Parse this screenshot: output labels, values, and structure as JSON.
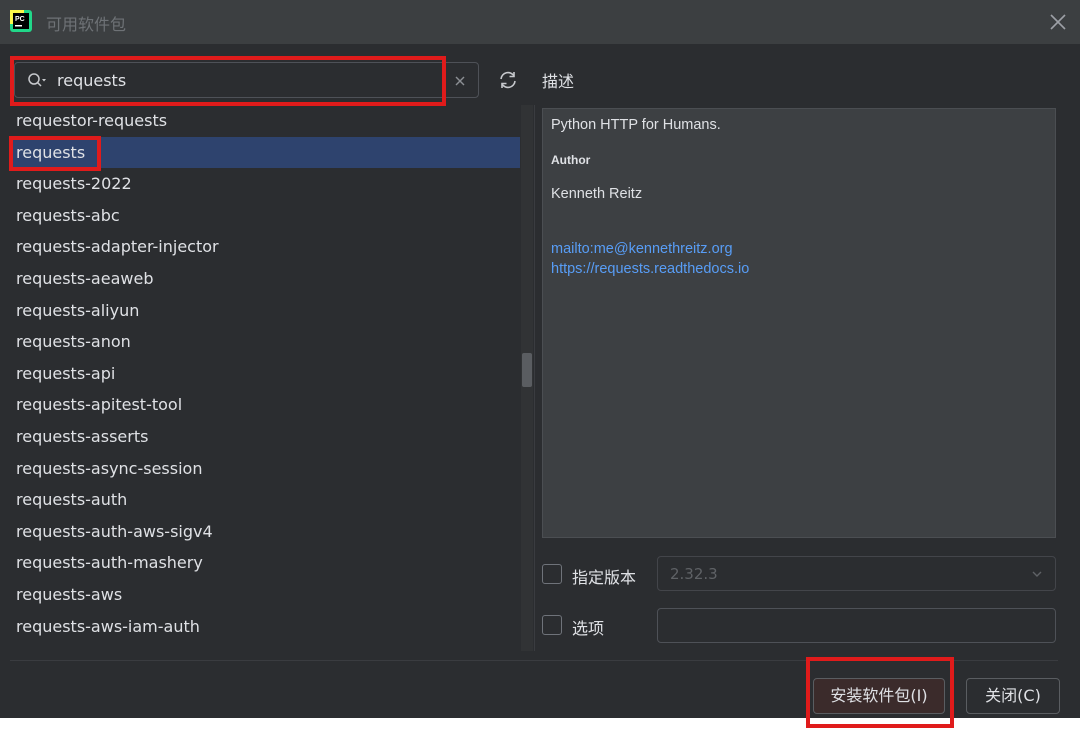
{
  "window": {
    "title": "可用软件包"
  },
  "search": {
    "value": "requests"
  },
  "packages": [
    "requestor-requests",
    "requests",
    "requests-2022",
    "requests-abc",
    "requests-adapter-injector",
    "requests-aeaweb",
    "requests-aliyun",
    "requests-anon",
    "requests-api",
    "requests-apitest-tool",
    "requests-asserts",
    "requests-async-session",
    "requests-auth",
    "requests-auth-aws-sigv4",
    "requests-auth-mashery",
    "requests-aws",
    "requests-aws-iam-auth"
  ],
  "selected_package": "requests",
  "description": {
    "label": "描述",
    "summary": "Python HTTP for Humans.",
    "author_label": "Author",
    "author": "Kenneth Reitz",
    "email": "mailto:me@kennethreitz.org",
    "url": "https://requests.readthedocs.io"
  },
  "options": {
    "specify_version_label": "指定版本",
    "version_value": "2.32.3",
    "options_label": "选项"
  },
  "buttons": {
    "install": "安装软件包(I)",
    "close": "关闭(C)"
  },
  "colors": {
    "highlight": "#e01b1b",
    "selection": "#2e436e",
    "link": "#589df6"
  }
}
